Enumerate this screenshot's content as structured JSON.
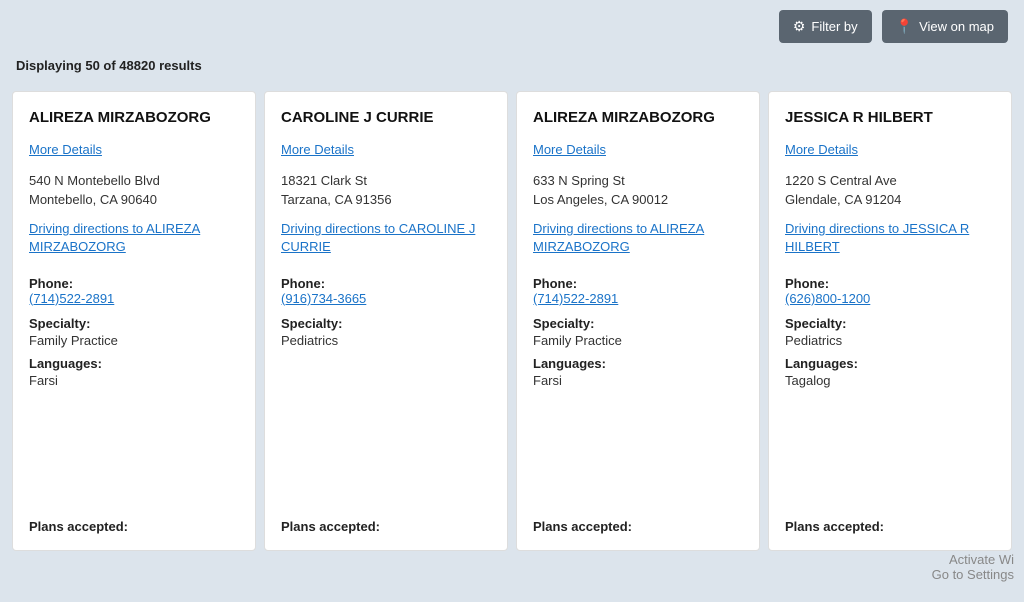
{
  "topbar": {
    "filter_btn": "Filter by",
    "map_btn": "View on map"
  },
  "results": {
    "text": "Displaying 50 of 48820 results"
  },
  "cards": [
    {
      "id": "card-1",
      "name": "ALIREZA MIRZABOZORG",
      "more_details": "More Details",
      "address_line1": "540 N Montebello Blvd",
      "address_line2": "Montebello, CA 90640",
      "directions": "Driving directions to ALIREZA MIRZABOZORG",
      "phone_label": "Phone:",
      "phone": "(714)522-2891",
      "specialty_label": "Specialty:",
      "specialty": "Family Practice",
      "languages_label": "Languages:",
      "languages": "Farsi",
      "plans_label": "Plans accepted:"
    },
    {
      "id": "card-2",
      "name": "CAROLINE J CURRIE",
      "more_details": "More Details",
      "address_line1": "18321 Clark St",
      "address_line2": "Tarzana, CA 91356",
      "directions": "Driving directions to CAROLINE J CURRIE",
      "phone_label": "Phone:",
      "phone": "(916)734-3665",
      "specialty_label": "Specialty:",
      "specialty": "Pediatrics",
      "languages_label": "",
      "languages": "",
      "plans_label": "Plans accepted:"
    },
    {
      "id": "card-3",
      "name": "ALIREZA MIRZABOZORG",
      "more_details": "More Details",
      "address_line1": "633 N Spring St",
      "address_line2": "Los Angeles, CA 90012",
      "directions": "Driving directions to ALIREZA MIRZABOZORG",
      "phone_label": "Phone:",
      "phone": "(714)522-2891",
      "specialty_label": "Specialty:",
      "specialty": "Family Practice",
      "languages_label": "Languages:",
      "languages": "Farsi",
      "plans_label": "Plans accepted:"
    },
    {
      "id": "card-4",
      "name": "JESSICA R HILBERT",
      "more_details": "More Details",
      "address_line1": "1220 S Central Ave",
      "address_line2": "Glendale, CA 91204",
      "directions": "Driving directions to JESSICA R HILBERT",
      "phone_label": "Phone:",
      "phone": "(626)800-1200",
      "specialty_label": "Specialty:",
      "specialty": "Pediatrics",
      "languages_label": "Languages:",
      "languages": "Tagalog",
      "plans_label": "Plans accepted:"
    }
  ],
  "watermark": {
    "line1": "Activate Wi",
    "line2": "Go to Settings"
  }
}
